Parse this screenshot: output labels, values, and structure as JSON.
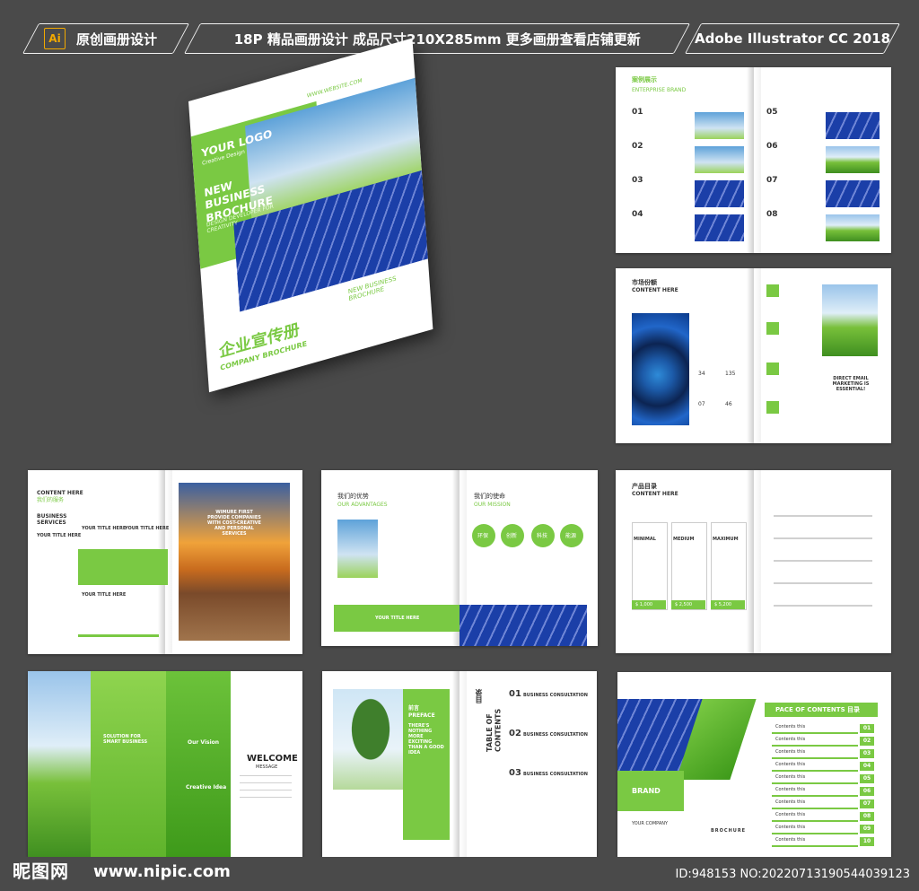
{
  "header": {
    "pill1": {
      "ai": "Ai",
      "label": "原创画册设计"
    },
    "pill2": {
      "label": "18P 精品画册设计 成品尺寸210X285mm 更多画册查看店铺更新"
    },
    "pill3": {
      "label": "Adobe Illustrator CC 2018"
    }
  },
  "cover": {
    "website": "WWW.WEBSITE.COM",
    "logo": "YOUR LOGO",
    "logo_sub": "Creative Design",
    "headline": "NEW BUSINESS BROCHURE",
    "tagline": "DESIGN DEVELOPER FOR CREATIVITY",
    "side_text": "NEW BUSINESS BROCHURE",
    "title_cn": "企业宣传册",
    "title_en": "COMPANY BROCHURE"
  },
  "spread1": {
    "title_cn": "案例展示",
    "title_en": "ENTERPRISE BRAND",
    "nums_left": [
      "01",
      "02",
      "03",
      "04"
    ],
    "nums_right": [
      "05",
      "06",
      "07",
      "08"
    ]
  },
  "spread2": {
    "title_cn": "市场份额",
    "title_en": "CONTENT HERE",
    "stats": [
      "34",
      "135",
      "07",
      "46"
    ],
    "cta": "DIRECT EMAIL MARKETING IS ESSENTIAL!"
  },
  "spread3": {
    "title": "CONTENT HERE",
    "title_cn": "我们的服务",
    "left_heading": "BUSINESS SERVICES",
    "item": "YOUR TITLE HERE",
    "quote": "WIMURE FIRST PROVIDE COMPANIES WITH COST-CREATIVE AND PERSONAL SERVICES"
  },
  "spread4": {
    "left_cn": "我们的优势",
    "left_en": "OUR ADVANTAGES",
    "right_cn": "我们的使命",
    "right_en": "OUR MISSION",
    "circles": [
      "环保",
      "创新",
      "科技",
      "能源"
    ],
    "band": "YOUR TITLE HERE"
  },
  "spread5": {
    "title_cn": "产品目录",
    "title_en": "CONTENT HERE",
    "plans": [
      "MINIMAL",
      "MEDIUM",
      "MAXIMUM"
    ],
    "prices": [
      "$ 1,000",
      "$ 2,500",
      "$ 5,200"
    ]
  },
  "spread6": {
    "left": "SOLUTION FOR SMART BUSINESS",
    "vision": "Our Vision",
    "creative": "Creative Idea",
    "welcome": "WELCOME",
    "message": "MESSAGE"
  },
  "spread7": {
    "box_cn": "前言",
    "box_en": "PREFACE",
    "box_text": "THERE'S NOTHING MORE EXCITING THAN A GOOD IDEA",
    "toc_cn": "目录",
    "toc_en": "TABLE OF CONTENTS",
    "items": [
      {
        "num": "01",
        "title": "BUSINESS CONSULTATION"
      },
      {
        "num": "02",
        "title": "BUSINESS CONSULTATION"
      },
      {
        "num": "03",
        "title": "BUSINESS CONSULTATION"
      }
    ]
  },
  "spread8": {
    "brand": "BRAND",
    "brand_sub": "YOUR COMPANY",
    "brochure": "BROCHURE",
    "banner": "PACE OF CONTENTS 目录",
    "rows": [
      "01",
      "02",
      "03",
      "04",
      "05",
      "06",
      "07",
      "08",
      "09",
      "10"
    ],
    "row_label": "Contents this"
  },
  "footer": {
    "logo": "昵图网",
    "url": "www.nipic.com",
    "id": "ID:948153 NO:20220713190544039123"
  }
}
